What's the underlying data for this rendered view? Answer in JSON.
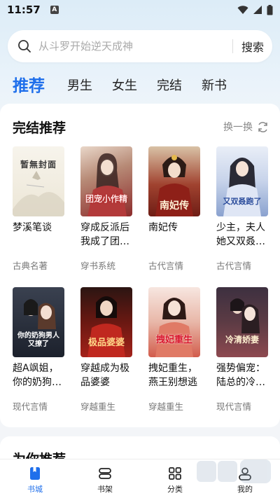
{
  "status": {
    "time": "11:57",
    "notif_letter": "A"
  },
  "search": {
    "placeholder": "从斗罗开始逆天成神",
    "button_label": "搜索"
  },
  "tabs": [
    {
      "label": "推荐",
      "active": true
    },
    {
      "label": "男生"
    },
    {
      "label": "女生"
    },
    {
      "label": "完结"
    },
    {
      "label": "新书"
    }
  ],
  "section": {
    "title": "完结推荐",
    "refresh_label": "换一换",
    "books": [
      {
        "title": "梦溪笔谈",
        "tag": "古典名著",
        "cover_text": "暂無封面"
      },
      {
        "title": "穿成反派后我成了团宠",
        "title_display": "穿成反派后我成了团…",
        "tag": "穿书系统",
        "cover_text": "团宠小作精"
      },
      {
        "title": "南妃传",
        "tag": "古代言情",
        "cover_text": "南妃传"
      },
      {
        "title": "少主，夫人她又双叒叕跑了",
        "title_display": "少主，夫人她又双叒…",
        "tag": "古代言情",
        "cover_text": "又双叒跑了"
      },
      {
        "title": "超A飒姐，你的奶狗男人又撩了",
        "title_display": "超A飒姐，你的奶狗…",
        "tag": "现代言情",
        "cover_text": "你的奶狗男人又撩了"
      },
      {
        "title": "穿越成为极品婆婆",
        "tag": "穿越重生",
        "cover_text": "极品婆婆"
      },
      {
        "title": "拽妃重生，燕王别想逃",
        "tag": "穿越重生",
        "cover_text": "拽妃重生"
      },
      {
        "title": "强势偏宠：陆总的冷清娇妻",
        "title_display": "强势偏宠：陆总的冷…",
        "tag": "现代言情",
        "cover_text": "冷清娇妻"
      }
    ]
  },
  "section2": {
    "title": "为你推荐"
  },
  "bottom_nav": [
    {
      "label": "书城",
      "active": true,
      "icon": "book-city-icon"
    },
    {
      "label": "书架",
      "icon": "bookshelf-icon"
    },
    {
      "label": "分类",
      "icon": "category-icon"
    },
    {
      "label": "我的",
      "icon": "profile-icon"
    }
  ],
  "colors": {
    "accent": "#1f6feb"
  }
}
